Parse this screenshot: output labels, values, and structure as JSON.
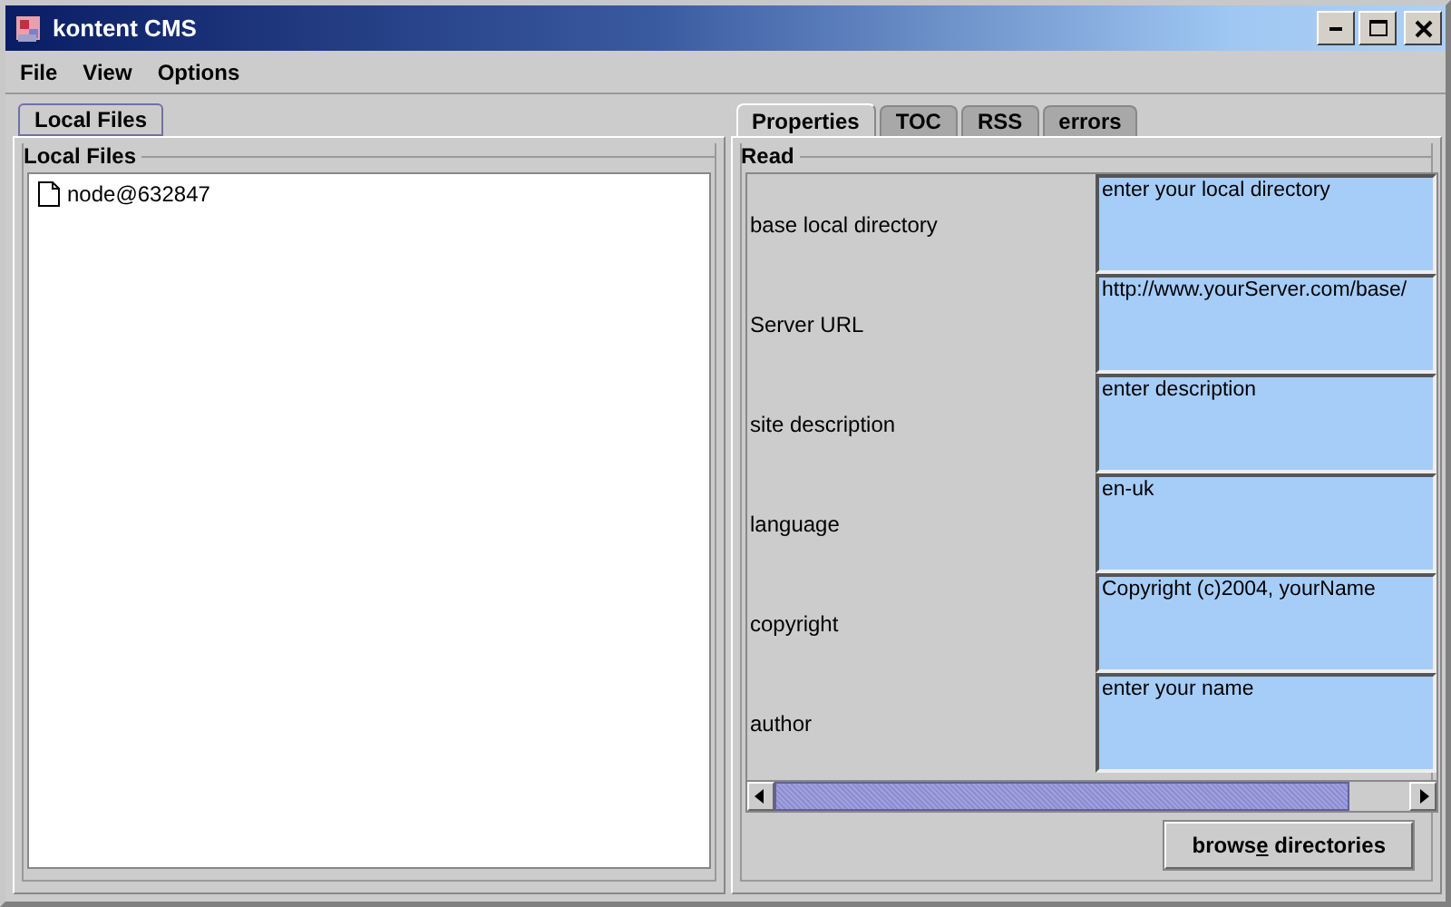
{
  "window": {
    "title": "kontent CMS"
  },
  "menu": [
    "File",
    "View",
    "Options"
  ],
  "left_tabs": [
    {
      "label": "Local Files",
      "selected": true
    }
  ],
  "local_files": {
    "title": "Local Files",
    "tree": [
      {
        "label": "node@632847",
        "kind": "file"
      }
    ]
  },
  "right_tabs": [
    {
      "label": "Properties",
      "selected": true
    },
    {
      "label": "TOC",
      "selected": false
    },
    {
      "label": "RSS",
      "selected": false
    },
    {
      "label": "errors",
      "selected": false
    }
  ],
  "properties": {
    "title": "Read",
    "rows": [
      {
        "label": "base local directory",
        "value": "enter your local directory"
      },
      {
        "label": "Server URL",
        "value": "http://www.yourServer.com/base/"
      },
      {
        "label": "site description",
        "value": "enter description"
      },
      {
        "label": "language",
        "value": "en-uk"
      },
      {
        "label": "copyright",
        "value": "Copyright (c)2004, yourName"
      },
      {
        "label": "author",
        "value": "enter your name"
      }
    ]
  },
  "browse_button": {
    "label_before": "brows",
    "mnemonic": "e",
    "label_after": " directories"
  }
}
